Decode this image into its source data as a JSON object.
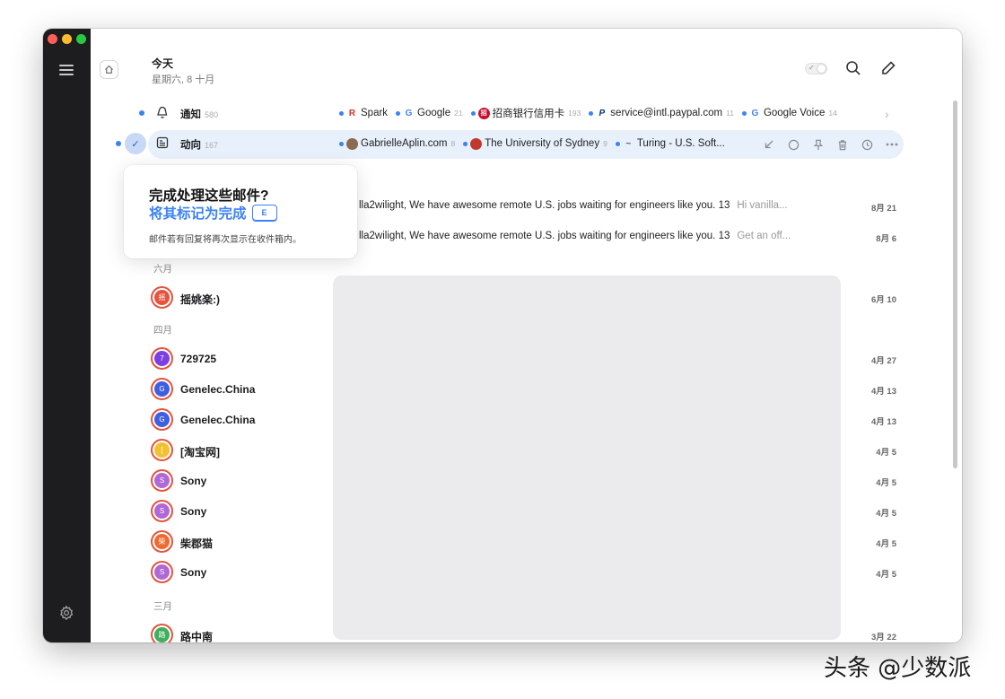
{
  "header": {
    "title": "今天",
    "subtitle": "星期六, 8 十月"
  },
  "splits": [
    {
      "label": "通知",
      "count": "580",
      "chips": [
        {
          "name": "Spark",
          "count": "",
          "icon_letter": "R",
          "icon_color": "#d93025"
        },
        {
          "name": "Google",
          "count": "21",
          "icon_letter": "G",
          "icon_color": "#4285f4"
        },
        {
          "name": "招商银行信用卡",
          "count": "193",
          "icon_letter": "招",
          "icon_color": "#c8102e"
        },
        {
          "name": "service@intl.paypal.com",
          "count": "11",
          "icon_letter": "P",
          "icon_color": "#003087"
        },
        {
          "name": "Google Voice",
          "count": "14",
          "icon_letter": "G",
          "icon_color": "#4285f4"
        }
      ]
    },
    {
      "label": "动向",
      "count": "167",
      "chips": [
        {
          "name": "GabrielleAplin.com",
          "count": "8",
          "icon_letter": "",
          "icon_color": "#8a6a50"
        },
        {
          "name": "The University of Sydney",
          "count": "9",
          "icon_letter": "",
          "icon_color": "#c0392b"
        },
        {
          "name": "Turing - U.S. Soft...",
          "count": "",
          "icon_letter": "~",
          "icon_color": "#555555"
        }
      ]
    }
  ],
  "popup": {
    "title": "完成处理这些邮件?",
    "action": "将其标记为完成",
    "key": "E",
    "note": "邮件若有回复将再次显示在收件箱内。"
  },
  "messages_top": [
    {
      "subject": "lla2wilight, We have awesome remote U.S. jobs waiting for engineers like you. 13",
      "preview": "Hi vanilla...",
      "date": "8月 21"
    },
    {
      "subject": "lla2wilight, We have awesome remote U.S. jobs waiting for engineers like you. 13",
      "preview": "Get an off...",
      "date": "8月 6"
    }
  ],
  "months": {
    "june": "六月",
    "april": "四月",
    "march": "三月"
  },
  "messages": [
    {
      "sender": "摇姚楽:)",
      "initial": "摇",
      "color": "#e5533d",
      "date": "6月 10"
    },
    {
      "sender": "729725",
      "initial": "7",
      "color": "#7b3fe4",
      "date": "4月 27"
    },
    {
      "sender": "Genelec.China",
      "initial": "G",
      "color": "#3f5fe0",
      "date": "4月 13"
    },
    {
      "sender": "Genelec.China",
      "initial": "G",
      "color": "#3f5fe0",
      "date": "4月 13"
    },
    {
      "sender": "[淘宝网]",
      "initial": "[",
      "color": "#f2c12e",
      "date": "4月 5"
    },
    {
      "sender": "Sony",
      "initial": "S",
      "color": "#b068d4",
      "date": "4月 5"
    },
    {
      "sender": "Sony",
      "initial": "S",
      "color": "#b068d4",
      "date": "4月 5"
    },
    {
      "sender": "柴郡猫",
      "initial": "柴",
      "color": "#ee6a2f",
      "date": "4月 5"
    },
    {
      "sender": "Sony",
      "initial": "S",
      "color": "#b068d4",
      "date": "4月 5"
    },
    {
      "sender": "路中南",
      "initial": "路",
      "color": "#3fae5e",
      "date": "3月 22"
    }
  ],
  "watermark": "头条 @少数派",
  "colors": {
    "accent": "#3a82f7",
    "sidebar": "#1d1d1f",
    "highlight": "#e8f0fc"
  }
}
